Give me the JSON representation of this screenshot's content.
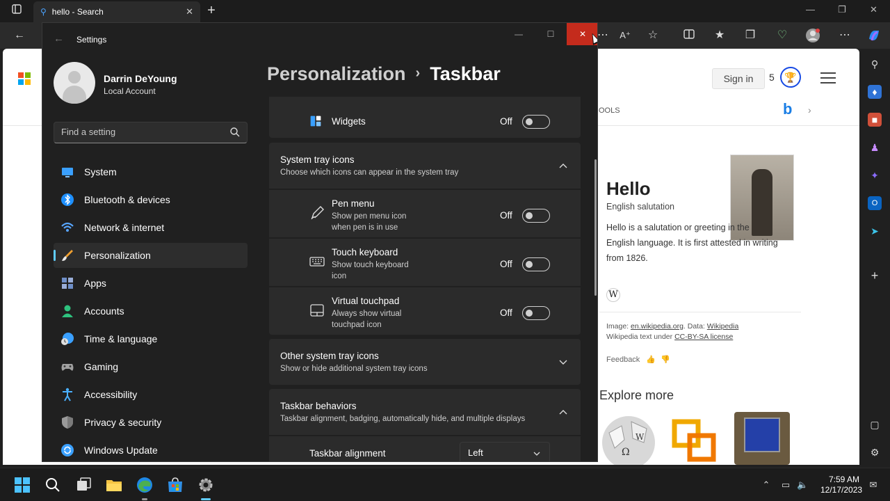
{
  "edge": {
    "tab_title": "hello - Search",
    "bing": {
      "signin_label": "Sign in",
      "points": "5",
      "nav_tools": "OOLS",
      "knowledge": {
        "title": "Hello",
        "subtitle": "English salutation",
        "description": "Hello is a salutation or greeting in the English language. It is first attested in writing from 1826.",
        "attr_image_prefix": "Image: ",
        "attr_image_link": "en.wikipedia.org",
        "attr_data_prefix": ". Data: ",
        "attr_data_link": "Wikipedia",
        "attr_text_prefix": "Wikipedia text under ",
        "attr_text_link": "CC-BY-SA license",
        "feedback_label": "Feedback"
      },
      "explore_title": "Explore more"
    }
  },
  "settings": {
    "window_title": "Settings",
    "user": {
      "name": "Darrin DeYoung",
      "account_type": "Local Account"
    },
    "search_placeholder": "Find a setting",
    "nav": [
      {
        "label": "System",
        "icon": "system-icon",
        "color": "#3aa0ff"
      },
      {
        "label": "Bluetooth & devices",
        "icon": "bluetooth-icon",
        "color": "#1e90ff"
      },
      {
        "label": "Network & internet",
        "icon": "wifi-icon",
        "color": "#58a6ff"
      },
      {
        "label": "Personalization",
        "icon": "brush-icon",
        "color": "#f0a030",
        "active": true
      },
      {
        "label": "Apps",
        "icon": "apps-icon",
        "color": "#8aa0c8"
      },
      {
        "label": "Accounts",
        "icon": "accounts-icon",
        "color": "#2ec27e"
      },
      {
        "label": "Time & language",
        "icon": "clock-globe-icon",
        "color": "#3aa0ff"
      },
      {
        "label": "Gaming",
        "icon": "controller-icon",
        "color": "#a0a0a0"
      },
      {
        "label": "Accessibility",
        "icon": "accessibility-icon",
        "color": "#4ab0ff"
      },
      {
        "label": "Privacy & security",
        "icon": "shield-icon",
        "color": "#9a9a9a"
      },
      {
        "label": "Windows Update",
        "icon": "update-icon",
        "color": "#3aa0ff"
      }
    ],
    "breadcrumb": {
      "parent": "Personalization",
      "current": "Taskbar"
    },
    "widgets": {
      "title": "Widgets",
      "state": "Off"
    },
    "system_tray": {
      "title": "System tray icons",
      "description": "Choose which icons can appear in the system tray",
      "items": [
        {
          "title": "Pen menu",
          "desc_line1": "Show pen menu icon",
          "desc_line2": "when pen is in use",
          "state": "Off",
          "icon": "pen-icon"
        },
        {
          "title": "Touch keyboard",
          "desc_line1": "Show touch keyboard",
          "desc_line2": "icon",
          "state": "Off",
          "icon": "keyboard-icon"
        },
        {
          "title": "Virtual touchpad",
          "desc_line1": "Always show virtual",
          "desc_line2": "touchpad icon",
          "state": "Off",
          "icon": "touchpad-icon"
        }
      ]
    },
    "other_tray": {
      "title": "Other system tray icons",
      "description": "Show or hide additional system tray icons"
    },
    "behaviors": {
      "title": "Taskbar behaviors",
      "description": "Taskbar alignment, badging, automatically hide, and multiple displays",
      "alignment_label": "Taskbar alignment",
      "alignment_value": "Left"
    }
  },
  "taskbar": {
    "time": "7:59 AM",
    "date": "12/17/2023"
  },
  "colors": {
    "accent": "#60cdff",
    "close_red": "#c42b1c",
    "window_bg": "#202020",
    "card_bg": "#2b2b2b"
  }
}
